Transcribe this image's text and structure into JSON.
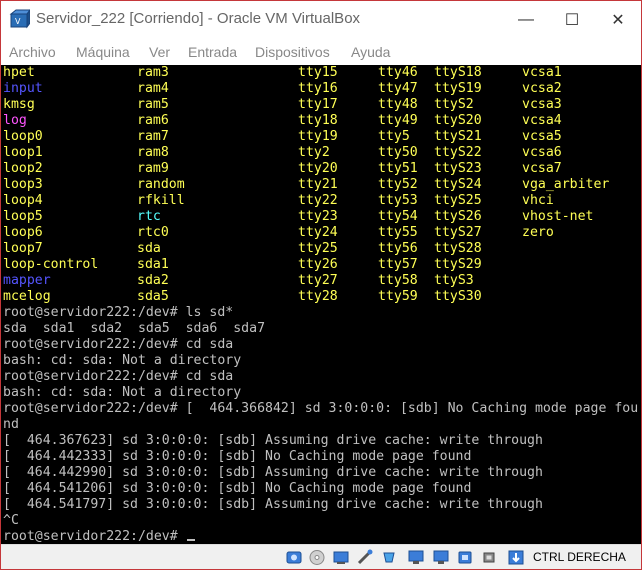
{
  "window": {
    "title": "Servidor_222 [Corriendo] - Oracle VM VirtualBox",
    "minimize": "—",
    "maximize": "☐",
    "close": "✕"
  },
  "menu": [
    "Archivo",
    "Máquina",
    "Ver",
    "Entrada",
    "Dispositivos",
    "Ayuda"
  ],
  "listing": {
    "col1": [
      {
        "t": "hpet",
        "c": "y"
      },
      {
        "t": "input",
        "c": "b"
      },
      {
        "t": "kmsg",
        "c": "y"
      },
      {
        "t": "log",
        "c": "m"
      },
      {
        "t": "loop0",
        "c": "y"
      },
      {
        "t": "loop1",
        "c": "y"
      },
      {
        "t": "loop2",
        "c": "y"
      },
      {
        "t": "loop3",
        "c": "y"
      },
      {
        "t": "loop4",
        "c": "y"
      },
      {
        "t": "loop5",
        "c": "y"
      },
      {
        "t": "loop6",
        "c": "y"
      },
      {
        "t": "loop7",
        "c": "y"
      },
      {
        "t": "loop-control",
        "c": "y"
      },
      {
        "t": "mapper",
        "c": "b"
      },
      {
        "t": "mcelog",
        "c": "y"
      }
    ],
    "col2": [
      {
        "t": "ram3",
        "c": "y"
      },
      {
        "t": "ram4",
        "c": "y"
      },
      {
        "t": "ram5",
        "c": "y"
      },
      {
        "t": "ram6",
        "c": "y"
      },
      {
        "t": "ram7",
        "c": "y"
      },
      {
        "t": "ram8",
        "c": "y"
      },
      {
        "t": "ram9",
        "c": "y"
      },
      {
        "t": "random",
        "c": "y"
      },
      {
        "t": "rfkill",
        "c": "y"
      },
      {
        "t": "rtc",
        "c": "c"
      },
      {
        "t": "rtc0",
        "c": "y"
      },
      {
        "t": "sda",
        "c": "y"
      },
      {
        "t": "sda1",
        "c": "y"
      },
      {
        "t": "sda2",
        "c": "y"
      },
      {
        "t": "sda5",
        "c": "y"
      }
    ],
    "col3": [
      "tty15",
      "tty16",
      "tty17",
      "tty18",
      "tty19",
      "tty2",
      "tty20",
      "tty21",
      "tty22",
      "tty23",
      "tty24",
      "tty25",
      "tty26",
      "tty27",
      "tty28"
    ],
    "col4": [
      "tty46",
      "tty47",
      "tty48",
      "tty49",
      "tty5",
      "tty50",
      "tty51",
      "tty52",
      "tty53",
      "tty54",
      "tty55",
      "tty56",
      "tty57",
      "tty58",
      "tty59"
    ],
    "col5": [
      "ttyS18",
      "ttyS19",
      "ttyS2",
      "ttyS20",
      "ttyS21",
      "ttyS22",
      "ttyS23",
      "ttyS24",
      "ttyS25",
      "ttyS26",
      "ttyS27",
      "ttyS28",
      "ttyS29",
      "ttyS3",
      "ttyS30"
    ],
    "col6": [
      "vcsa1",
      "vcsa2",
      "vcsa3",
      "vcsa4",
      "vcsa5",
      "vcsa6",
      "vcsa7",
      "vga_arbiter",
      "vhci",
      "vhost-net",
      "zero"
    ]
  },
  "session": [
    "root@servidor222:/dev# ls sd*",
    "sda  sda1  sda2  sda5  sda6  sda7",
    "root@servidor222:/dev# cd sda",
    "bash: cd: sda: Not a directory",
    "root@servidor222:/dev# cd sda",
    "bash: cd: sda: Not a directory",
    "root@servidor222:/dev# [  464.366842] sd 3:0:0:0: [sdb] No Caching mode page fou",
    "nd",
    "[  464.367623] sd 3:0:0:0: [sdb] Assuming drive cache: write through",
    "[  464.442333] sd 3:0:0:0: [sdb] No Caching mode page found",
    "[  464.442990] sd 3:0:0:0: [sdb] Assuming drive cache: write through",
    "[  464.541206] sd 3:0:0:0: [sdb] No Caching mode page found",
    "[  464.541797] sd 3:0:0:0: [sdb] Assuming drive cache: write through",
    "^C",
    "root@servidor222:/dev# "
  ],
  "statusbar": {
    "icons": [
      "hard-disk-icon",
      "optical-drive-icon",
      "audio-icon",
      "network-icon",
      "usb-icon",
      "shared-folders-icon",
      "display-icon",
      "video-capture-icon",
      "cpu-icon",
      "mouse-integration-icon",
      "download-icon"
    ],
    "hostkey": "CTRL DERECHA"
  }
}
